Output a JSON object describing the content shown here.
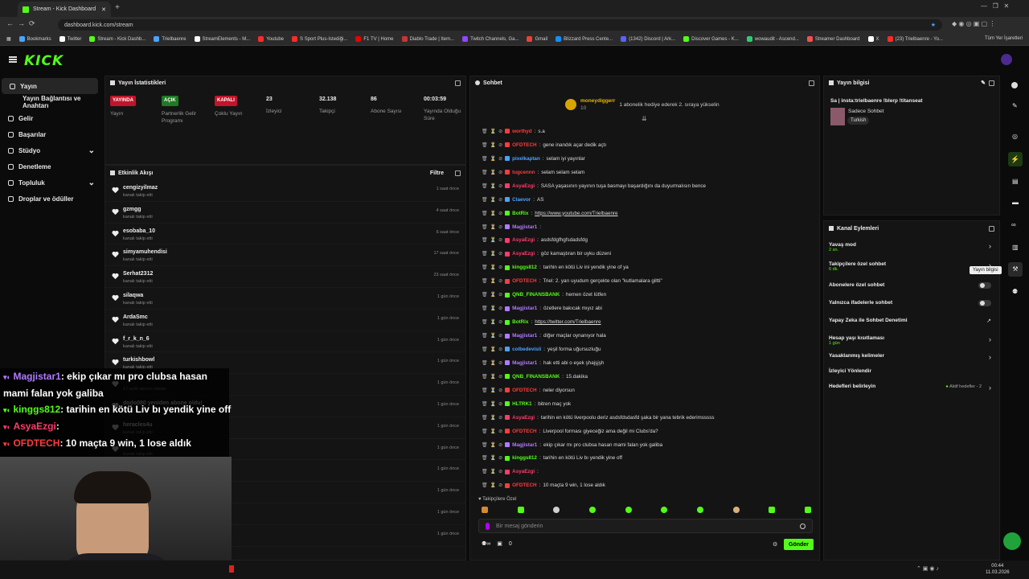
{
  "browser": {
    "tab_title": "Stream - Kick Dashboard",
    "url": "dashboard.kick.com/stream",
    "bookmarks": [
      "Bookmarks",
      "Twitter",
      "Stream - Kick Dashb...",
      "Trielbaenre",
      "StreamElements - M...",
      "Youtube",
      "S Sport Plus-İstediği...",
      "F1 TV | Home",
      "Diablo Trade | Item...",
      "Twitch Channels, Ga...",
      "Gmail",
      "Blizzard Press Cente...",
      "(1342) Discord | Ark...",
      "Discover Games - K...",
      "wowaudit - Ascend...",
      "Streamer Dashboard",
      "X",
      "(23) Trielbaenre - Yo..."
    ],
    "all_bookmarks": "Tüm Yer İşaretleri"
  },
  "brand": {
    "logo": "KICK",
    "accent": "#53fc18"
  },
  "sidebar": {
    "items": [
      {
        "label": "Yayın",
        "active": true
      },
      {
        "label": "Yayın Bağlantısı ve Anahtarı",
        "sub": true
      },
      {
        "label": "Gelir"
      },
      {
        "label": "Başarılar"
      },
      {
        "label": "Stüdyo",
        "chevron": true
      },
      {
        "label": "Denetleme"
      },
      {
        "label": "Topluluk",
        "chevron": true
      },
      {
        "label": "Droplar ve ödüller"
      }
    ]
  },
  "stats": {
    "title": "Yayın İstatistikleri",
    "items": [
      {
        "badge": "YAYINDA",
        "label": "Yayın",
        "color": "red"
      },
      {
        "badge": "AÇIK",
        "label": "Partnerlik Gelir Programı",
        "color": "green"
      },
      {
        "badge": "KAPALI",
        "label": "Çoklu Yayın",
        "color": "red"
      },
      {
        "value": "23",
        "label": "İzleyici"
      },
      {
        "value": "32.138",
        "label": "Takipçi"
      },
      {
        "value": "86",
        "label": "Abone Sayısı"
      },
      {
        "value": "00:03:59",
        "label": "Yayında Olduğu Süre"
      }
    ]
  },
  "activity": {
    "title": "Etkinlik Akışı",
    "filter": "Filtre",
    "items": [
      {
        "name": "cengizyilmaz",
        "sub": "kanalı takip etti",
        "time": "1 saat önce"
      },
      {
        "name": "gzmgg",
        "sub": "kanalı takip etti",
        "time": "4 saat önce"
      },
      {
        "name": "esobaba_10",
        "sub": "kanalı takip etti",
        "time": "6 saat önce"
      },
      {
        "name": "simyamuhendisi",
        "sub": "kanalı takip etti",
        "time": "17 saat önce"
      },
      {
        "name": "Serhat2312",
        "sub": "kanalı takip etti",
        "time": "23 saat önce"
      },
      {
        "name": "silaqwa",
        "sub": "kanalı takip etti",
        "time": "1 gün önce"
      },
      {
        "name": "ArdaSmc",
        "sub": "kanalı takip etti",
        "time": "1 gün önce"
      },
      {
        "name": "f_r_k_n_6",
        "sub": "kanalı takip etti",
        "time": "1 gün önce"
      },
      {
        "name": "turkishbowl",
        "sub": "kanalı takip etti",
        "time": "1 gün önce"
      },
      {
        "name": "",
        "sub": "17 aylık abone oldular",
        "time": "1 gün önce"
      },
      {
        "name": "dodo080 yeniden abone oldu!",
        "sub": "",
        "time": "1 gün önce"
      },
      {
        "name": "heracles4u",
        "sub": "kanalı takip etti",
        "time": "1 gün önce"
      },
      {
        "name": "",
        "sub": "kanalı takip etti",
        "time": "1 gün önce"
      },
      {
        "name": "",
        "sub": "",
        "time": "1 gün önce"
      },
      {
        "name": "",
        "sub": "",
        "time": "1 gün önce"
      },
      {
        "name": "",
        "sub": "",
        "time": "1 gün önce"
      },
      {
        "name": "",
        "sub": "",
        "time": "1 gün önce"
      }
    ]
  },
  "chat": {
    "title": "Sohbet",
    "pinned_user": "moneydiggerr",
    "pinned_level": "10",
    "pinned_text": "1 abonelik hediye ederek 2. sıraya yükselin",
    "messages": [
      {
        "user": "worthyd",
        "color": "#ff3b3b",
        "text": "s.a"
      },
      {
        "user": "OFDTECH",
        "color": "#ff3b3b",
        "text": "gene inandık açar dedik açtı"
      },
      {
        "user": "pixelkaptan",
        "color": "#4aa3ff",
        "text": "selam iyi yayınlar"
      },
      {
        "user": "tugcennn",
        "color": "#ff3b3b",
        "text": "selam selam selam"
      },
      {
        "user": "AsyaEzgi",
        "color": "#ff3b6b",
        "text": "SASA yaşasının yayının tuşa basmayı başardığını da duyurmalısın bence"
      },
      {
        "user": "Claevor",
        "color": "#4aa3ff",
        "text": "AS"
      },
      {
        "user": "BotRix",
        "color": "#53fc18",
        "text": "https://www.youtube.com/Trielbaenre"
      },
      {
        "user": "Magjistar1",
        "color": "#b07bff",
        "text": ""
      },
      {
        "user": "AsyaEzgi",
        "color": "#ff3b6b",
        "text": "asdsfdgfhgfsdadsfdg"
      },
      {
        "user": "AsyaEzgi",
        "color": "#ff3b6b",
        "text": "göz kamaştıran bir uyku düzeni"
      },
      {
        "user": "kinggs812",
        "color": "#53fc18",
        "text": "tarihin en kötü Liv ini yendik yine of ya"
      },
      {
        "user": "OFDTECH",
        "color": "#ff3b3b",
        "text": "Triel: 2. yarı uyudum gerçekte olan \"kutlamalara giltti\""
      },
      {
        "user": "QNB_FINANSBANK",
        "color": "#53fc18",
        "text": "hemen özet lütfen"
      },
      {
        "user": "Magjistar1",
        "color": "#b07bff",
        "text": "özetlere bakıcak mıyız abi"
      },
      {
        "user": "BotRix",
        "color": "#53fc18",
        "text": "https://twitter.com/Trielbaenre"
      },
      {
        "user": "Magjistar1",
        "color": "#b07bff",
        "text": "diğer maçlar oynanıyor hala"
      },
      {
        "user": "colbedevisli",
        "color": "#4aa3ff",
        "text": "yeşil forma uğursuzluğu"
      },
      {
        "user": "Magjistar1",
        "color": "#b07bff",
        "text": "hak etti abi o eşek şhajşjşh"
      },
      {
        "user": "QNB_FINANSBANK",
        "color": "#53fc18",
        "text": "15.dakika"
      },
      {
        "user": "OFDTECH",
        "color": "#ff3b3b",
        "text": "neler diyorsun"
      },
      {
        "user": "HLTRK1",
        "color": "#53fc18",
        "text": "bitren maç yok"
      },
      {
        "user": "AsyaEzgi",
        "color": "#ff3b6b",
        "text": "tarihin en kötü liverpoolu deriz asdsfdsdasfd şaka bir yana tebrik ederimsssss"
      },
      {
        "user": "OFDTECH",
        "color": "#ff3b3b",
        "text": "Liverpool forması giyeceğiz ama değil mi Clubs'da?"
      },
      {
        "user": "Magjistar1",
        "color": "#b07bff",
        "text": "ekip çıkar mı pro clubsa hasan mami falan yok galiba"
      },
      {
        "user": "kinggs812",
        "color": "#53fc18",
        "text": "tarihin en kötü Liv bı yendik yine off"
      },
      {
        "user": "AsyaEzgi",
        "color": "#ff3b6b",
        "text": ""
      },
      {
        "user": "OFDTECH",
        "color": "#ff3b3b",
        "text": "10 maçta 9 win, 1 lose aldık"
      }
    ],
    "mode_label": "Takipçilere Özel",
    "input_placeholder": "Bir mesaj gönderin",
    "points": "0",
    "send": "Gönder"
  },
  "stream_info": {
    "title": "Yayın bilgisi",
    "stream_title": "Sa | insta:trielbaenre !blerp !titanseat",
    "chat_mode": "Sadece Sohbet",
    "language": "Turkish"
  },
  "channel_actions": {
    "title": "Kanal Eylemleri",
    "rows": [
      {
        "label": "Yavaş mod",
        "sub": "2 sn.",
        "ctrl": "chev"
      },
      {
        "label": "Takipçilere özel sohbet",
        "sub": "6 dk.",
        "ctrl": "chev"
      },
      {
        "label": "Abonelere özel sohbet",
        "ctrl": "toggle"
      },
      {
        "label": "Yalnızca ifadelerle sohbet",
        "ctrl": "toggle"
      },
      {
        "label": "Yapay Zeka ile Sohbet Denetimi",
        "ctrl": "ext"
      },
      {
        "label": "Hesap yaşı kısıtlaması",
        "sub": "1 gün",
        "ctrl": "chev"
      },
      {
        "label": "Yasaklanmış kelimeler",
        "ctrl": "chev"
      },
      {
        "label": "İzleyici Yönlendir",
        "ctrl": ""
      },
      {
        "label": "Hedefleri belirleyin",
        "extra": "Aktif hedefler - 2",
        "ctrl": "chev"
      }
    ],
    "tooltip": "Yayın bilgisi"
  },
  "overlay": {
    "lines": [
      {
        "user": "Magjistar1",
        "color": "#b07bff",
        "text": ": ekip çıkar mı pro clubsa hasan"
      },
      {
        "user": "",
        "color": "#fff",
        "text": "mami falan yok galiba"
      },
      {
        "user": "kinggs812",
        "color": "#53fc18",
        "text": ": tarihin en kötü Liv bı yendik yine off"
      },
      {
        "user": "AsyaEzgi",
        "color": "#ff3b6b",
        "text": ":"
      },
      {
        "user": "OFDTECH",
        "color": "#ff3b3b",
        "text": ": 10 maçta 9 win, 1 lose aldık"
      }
    ]
  },
  "taskbar": {
    "time": "00:44",
    "date": "11.03.2026"
  }
}
